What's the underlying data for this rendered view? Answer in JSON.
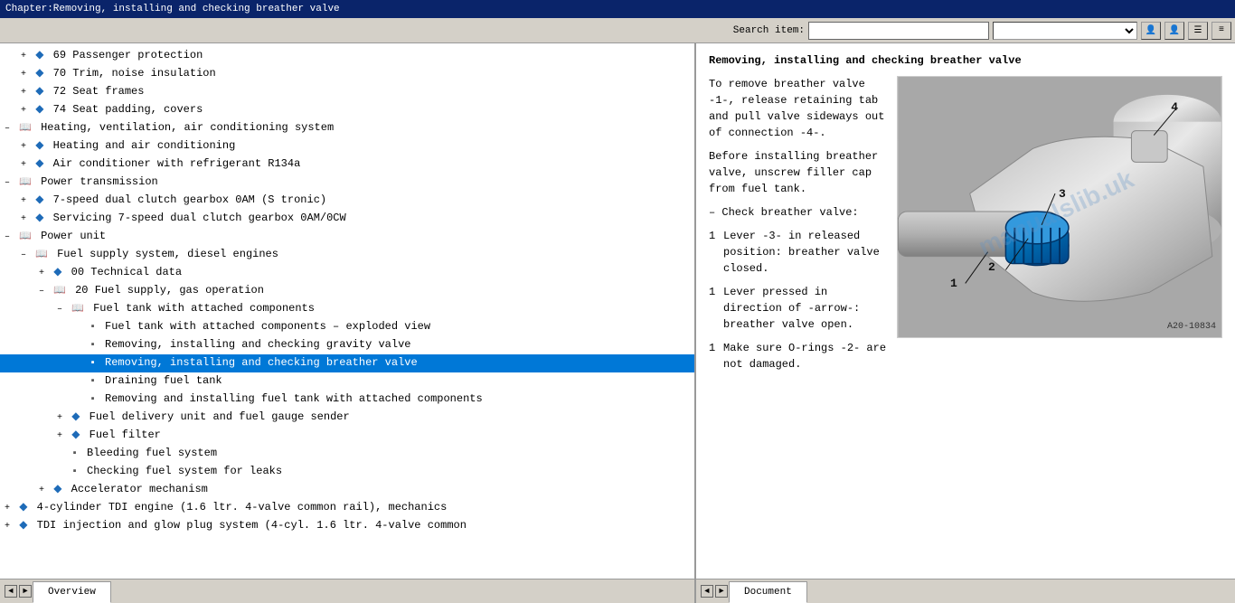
{
  "titlebar": {
    "text": "Chapter:Removing, installing and checking breather valve"
  },
  "toolbar": {
    "search_label": "Search item:",
    "search_placeholder": "",
    "buttons": [
      "user1",
      "user2",
      "menu1",
      "menu2"
    ]
  },
  "tree": {
    "items": [
      {
        "id": "t1",
        "label": "69  Passenger protection",
        "indent": 1,
        "type": "diamond",
        "expand": "plus"
      },
      {
        "id": "t2",
        "label": "70  Trim, noise insulation",
        "indent": 1,
        "type": "diamond",
        "expand": "plus"
      },
      {
        "id": "t3",
        "label": "72  Seat frames",
        "indent": 1,
        "type": "diamond",
        "expand": "plus"
      },
      {
        "id": "t4",
        "label": "74  Seat padding, covers",
        "indent": 1,
        "type": "diamond",
        "expand": "plus"
      },
      {
        "id": "t5",
        "label": "Heating, ventilation, air conditioning system",
        "indent": 0,
        "type": "book",
        "expand": "minus"
      },
      {
        "id": "t6",
        "label": "Heating and air conditioning",
        "indent": 1,
        "type": "diamond",
        "expand": "plus"
      },
      {
        "id": "t7",
        "label": "Air conditioner with refrigerant R134a",
        "indent": 1,
        "type": "diamond",
        "expand": "plus"
      },
      {
        "id": "t8",
        "label": "Power transmission",
        "indent": 0,
        "type": "book",
        "expand": "minus"
      },
      {
        "id": "t9",
        "label": "7-speed dual clutch gearbox 0AM (S tronic)",
        "indent": 1,
        "type": "diamond",
        "expand": "plus"
      },
      {
        "id": "t10",
        "label": "Servicing 7-speed dual clutch gearbox 0AM/0CW",
        "indent": 1,
        "type": "diamond",
        "expand": "plus"
      },
      {
        "id": "t11",
        "label": "Power unit",
        "indent": 0,
        "type": "book",
        "expand": "minus"
      },
      {
        "id": "t12",
        "label": "Fuel supply system, diesel engines",
        "indent": 1,
        "type": "book",
        "expand": "minus"
      },
      {
        "id": "t13",
        "label": "00  Technical data",
        "indent": 2,
        "type": "diamond",
        "expand": "plus"
      },
      {
        "id": "t14",
        "label": "20  Fuel supply, gas operation",
        "indent": 2,
        "type": "book",
        "expand": "minus"
      },
      {
        "id": "t15",
        "label": "Fuel tank with attached components",
        "indent": 3,
        "type": "book",
        "expand": "minus"
      },
      {
        "id": "t16",
        "label": "Fuel tank with attached components – exploded view",
        "indent": 4,
        "type": "doc",
        "expand": ""
      },
      {
        "id": "t17",
        "label": "Removing, installing and checking gravity valve",
        "indent": 4,
        "type": "doc",
        "expand": ""
      },
      {
        "id": "t18",
        "label": "Removing, installing and checking breather valve",
        "indent": 4,
        "type": "doc",
        "expand": "",
        "selected": true
      },
      {
        "id": "t19",
        "label": "Draining fuel tank",
        "indent": 4,
        "type": "doc",
        "expand": ""
      },
      {
        "id": "t20",
        "label": "Removing and installing fuel tank with attached components",
        "indent": 4,
        "type": "doc",
        "expand": ""
      },
      {
        "id": "t21",
        "label": "Fuel delivery unit and fuel gauge sender",
        "indent": 3,
        "type": "diamond",
        "expand": "plus"
      },
      {
        "id": "t22",
        "label": "Fuel filter",
        "indent": 3,
        "type": "diamond",
        "expand": "plus"
      },
      {
        "id": "t23",
        "label": "Bleeding fuel system",
        "indent": 3,
        "type": "doc",
        "expand": ""
      },
      {
        "id": "t24",
        "label": "Checking fuel system for leaks",
        "indent": 3,
        "type": "doc",
        "expand": ""
      },
      {
        "id": "t25",
        "label": "Accelerator mechanism",
        "indent": 2,
        "type": "diamond",
        "expand": "plus"
      },
      {
        "id": "t26",
        "label": "4-cylinder TDI engine (1.6 ltr. 4-valve common rail), mechanics",
        "indent": 0,
        "type": "diamond",
        "expand": "plus"
      },
      {
        "id": "t27",
        "label": "TDI injection and glow plug system (4-cyl. 1.6 ltr. 4-valve common",
        "indent": 0,
        "type": "diamond",
        "expand": "plus"
      }
    ]
  },
  "document": {
    "title": "Removing, installing and checking breather valve",
    "paragraphs": [
      {
        "bullet": "",
        "text": "To remove breather valve -1-, release retaining tab and pull valve sideways out of connection -4-."
      },
      {
        "bullet": "",
        "text": "Before installing breather valve, unscrew filler cap from fuel tank."
      },
      {
        "bullet": "–",
        "text": "Check breather valve:"
      },
      {
        "bullet": "1",
        "text": "Lever -3- in released position: breather valve closed."
      },
      {
        "bullet": "1",
        "text": "Lever pressed in direction of -arrow-: breather valve open."
      },
      {
        "bullet": "1",
        "text": "Make sure O-rings -2- are not damaged."
      }
    ],
    "image_label": "A20-10834",
    "watermark": "manualslib.uk"
  },
  "statusbar": {
    "left_tab": "Overview",
    "right_tab": "Document"
  }
}
